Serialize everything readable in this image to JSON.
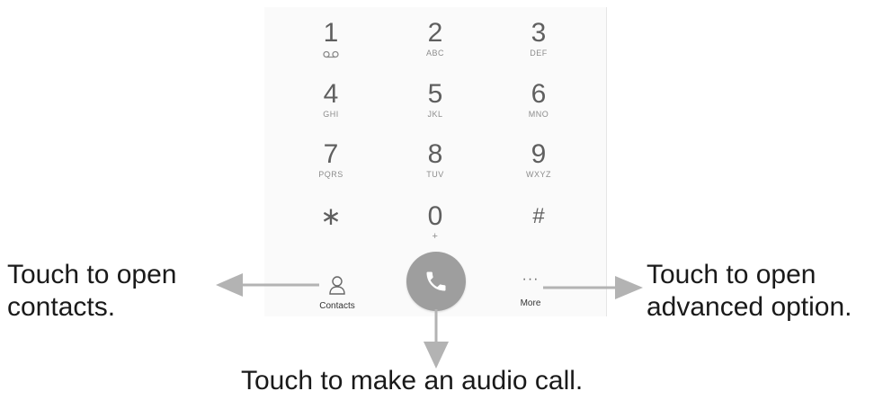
{
  "dialpad": {
    "keys": [
      {
        "digit": "1",
        "letters": ""
      },
      {
        "digit": "2",
        "letters": "ABC"
      },
      {
        "digit": "3",
        "letters": "DEF"
      },
      {
        "digit": "4",
        "letters": "GHI"
      },
      {
        "digit": "5",
        "letters": "JKL"
      },
      {
        "digit": "6",
        "letters": "MNO"
      },
      {
        "digit": "7",
        "letters": "PQRS"
      },
      {
        "digit": "8",
        "letters": "TUV"
      },
      {
        "digit": "9",
        "letters": "WXYZ"
      },
      {
        "digit": "∗",
        "letters": ""
      },
      {
        "digit": "0",
        "letters": "+"
      },
      {
        "digit": "#",
        "letters": ""
      }
    ]
  },
  "bottom_bar": {
    "contacts_label": "Contacts",
    "more_label": "More",
    "more_glyph": "···"
  },
  "callouts": {
    "contacts": {
      "line1": "Touch to open",
      "line2": "contacts."
    },
    "more": {
      "line1": "Touch to open",
      "line2": "advanced option."
    },
    "call": {
      "text": "Touch to make an audio call."
    }
  },
  "colors": {
    "call_button": "#9e9e9e",
    "arrow": "#b3b3b3",
    "panel": "#fafafa"
  },
  "icons": {
    "voicemail": "voicemail-icon",
    "contacts": "person-icon",
    "call": "phone-handset-icon",
    "more": "ellipsis-icon"
  }
}
